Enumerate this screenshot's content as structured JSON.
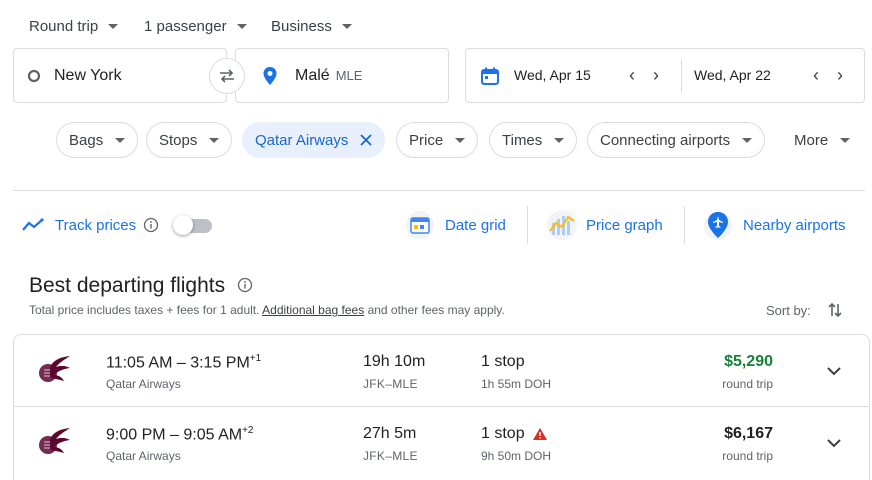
{
  "top_selectors": {
    "trip_type": "Round trip",
    "passengers": "1 passenger",
    "cabin": "Business"
  },
  "search": {
    "origin": "New York",
    "destination": "Malé",
    "destination_code": "MLE",
    "depart_date": "Wed, Apr 15",
    "return_date": "Wed, Apr 22"
  },
  "filters": {
    "bags": "Bags",
    "stops": "Stops",
    "airline": "Qatar Airways",
    "price": "Price",
    "times": "Times",
    "connecting": "Connecting airports",
    "more": "More"
  },
  "tools": {
    "track_prices": "Track prices",
    "track_prices_enabled": false,
    "date_grid": "Date grid",
    "price_graph": "Price graph",
    "nearby_airports": "Nearby airports"
  },
  "results_header": {
    "title": "Best departing flights",
    "subtext_before": "Total price includes taxes + fees for 1 adult.",
    "bag_fees_link": "Additional bag fees",
    "subtext_after": "and other fees may apply.",
    "sort_by": "Sort by:"
  },
  "flights": [
    {
      "depart_arrive": "11:05 AM – 3:15 PM",
      "day_offset": "+1",
      "airline": "Qatar Airways",
      "duration": "19h 10m",
      "route": "JFK–MLE",
      "stops": "1 stop",
      "layover": "1h 55m DOH",
      "price": "$5,290",
      "price_note": "round trip",
      "price_color": "#188038",
      "warning": false
    },
    {
      "depart_arrive": "9:00 PM – 9:05 AM",
      "day_offset": "+2",
      "airline": "Qatar Airways",
      "duration": "27h 5m",
      "route": "JFK–MLE",
      "stops": "1 stop",
      "layover": "9h 50m DOH",
      "price": "$6,167",
      "price_note": "round trip",
      "price_color": "#202124",
      "warning": true
    }
  ],
  "colors": {
    "accent_blue": "#1a73e8",
    "chip_selected_bg": "#e8f0fe",
    "price_green": "#188038",
    "warning_red": "#d93025",
    "qatar_maroon": "#5c0632"
  }
}
